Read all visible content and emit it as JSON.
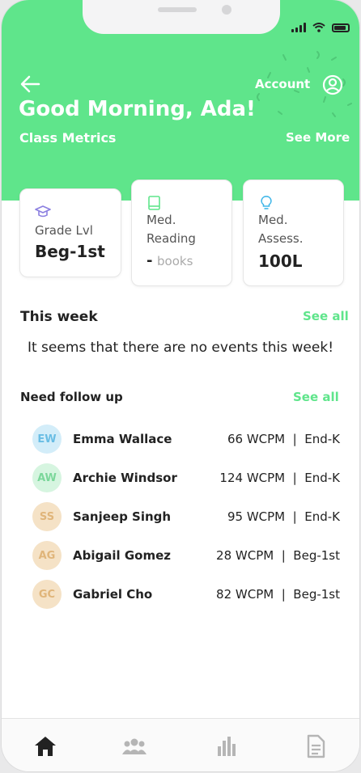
{
  "header": {
    "account_label": "Account",
    "greeting": "Good Morning, Ada!",
    "subtitle": "Class Metrics",
    "see_more": "See More",
    "color": "#5fe58b"
  },
  "icons": {
    "back": "arrow-left-icon",
    "account": "user-circle-icon",
    "grade": "graduation-cap-icon",
    "reading": "book-icon",
    "assessment": "lightbulb-icon"
  },
  "metrics": [
    {
      "label_lines": [
        "Grade Lvl"
      ],
      "value": "Beg-1st",
      "unit": ""
    },
    {
      "label_lines": [
        "Med.",
        "Reading"
      ],
      "value": "-",
      "unit": "books"
    },
    {
      "label_lines": [
        "Med.",
        "Assess."
      ],
      "value": "100L",
      "unit": ""
    }
  ],
  "this_week": {
    "title": "This week",
    "see_all": "See all",
    "empty_message": "It seems that there are no events this week!"
  },
  "follow_up": {
    "title": "Need follow up",
    "see_all": "See all",
    "students": [
      {
        "initials": "EW",
        "name": "Emma Wallace",
        "metric": "66 WCPM  |  End-K",
        "bg": "#d3edf9",
        "fg": "#69bde4"
      },
      {
        "initials": "AW",
        "name": "Archie Windsor",
        "metric": "124 WCPM  |  End-K",
        "bg": "#d6f5e0",
        "fg": "#7bd79a"
      },
      {
        "initials": "SS",
        "name": "Sanjeep Singh",
        "metric": "95 WCPM  |  End-K",
        "bg": "#f5e2c6",
        "fg": "#e0b57a"
      },
      {
        "initials": "AG",
        "name": "Abigail Gomez",
        "metric": "28 WCPM  |  Beg-1st",
        "bg": "#f5e2c6",
        "fg": "#e0b57a"
      },
      {
        "initials": "GC",
        "name": "Gabriel Cho",
        "metric": "82 WCPM  |  Beg-1st",
        "bg": "#f5e2c6",
        "fg": "#e0b57a"
      }
    ]
  },
  "tabbar": {
    "tabs": [
      "home-icon",
      "group-icon",
      "bar-chart-icon",
      "document-icon"
    ],
    "active": 0
  }
}
